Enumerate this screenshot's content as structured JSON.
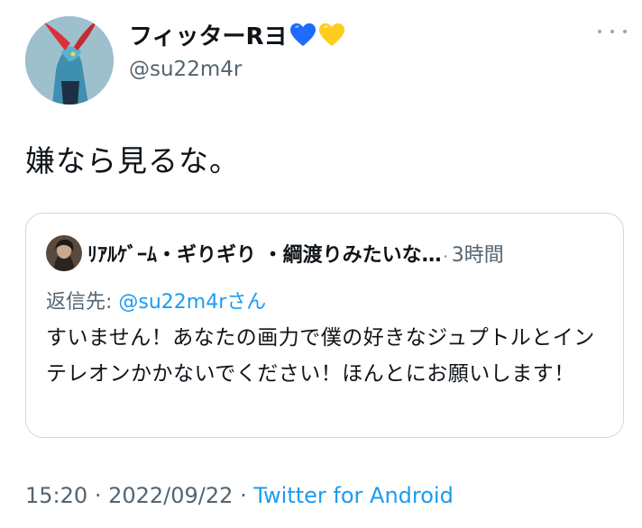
{
  "author": {
    "display_name": "フィッターRヨ",
    "handle": "@su22m4r"
  },
  "tweet": {
    "text": "嫌なら見るな。",
    "timestamp": "15:20",
    "date": "2022/09/22",
    "separator": "·",
    "source": "Twitter for Android"
  },
  "quoted_tweet": {
    "author_name": "ﾘｱﾙｹﾞｰﾑ・ギりギり ・綱渡りみたいな…",
    "separator": "·",
    "time": "3時間",
    "reply_prefix": "返信先: ",
    "reply_mention": "@su22m4r",
    "reply_suffix": "さん",
    "text": "すいません！あなたの画力で僕の好きなジュプトルとインテレオンかかないでください！ほんとにお願いします！"
  },
  "colors": {
    "accent": "#1d9bf0",
    "secondary_text": "#536471",
    "border": "#cfd9de"
  },
  "icons": [
    "blue-heart-icon",
    "yellow-heart-icon",
    "more-options-icon"
  ]
}
